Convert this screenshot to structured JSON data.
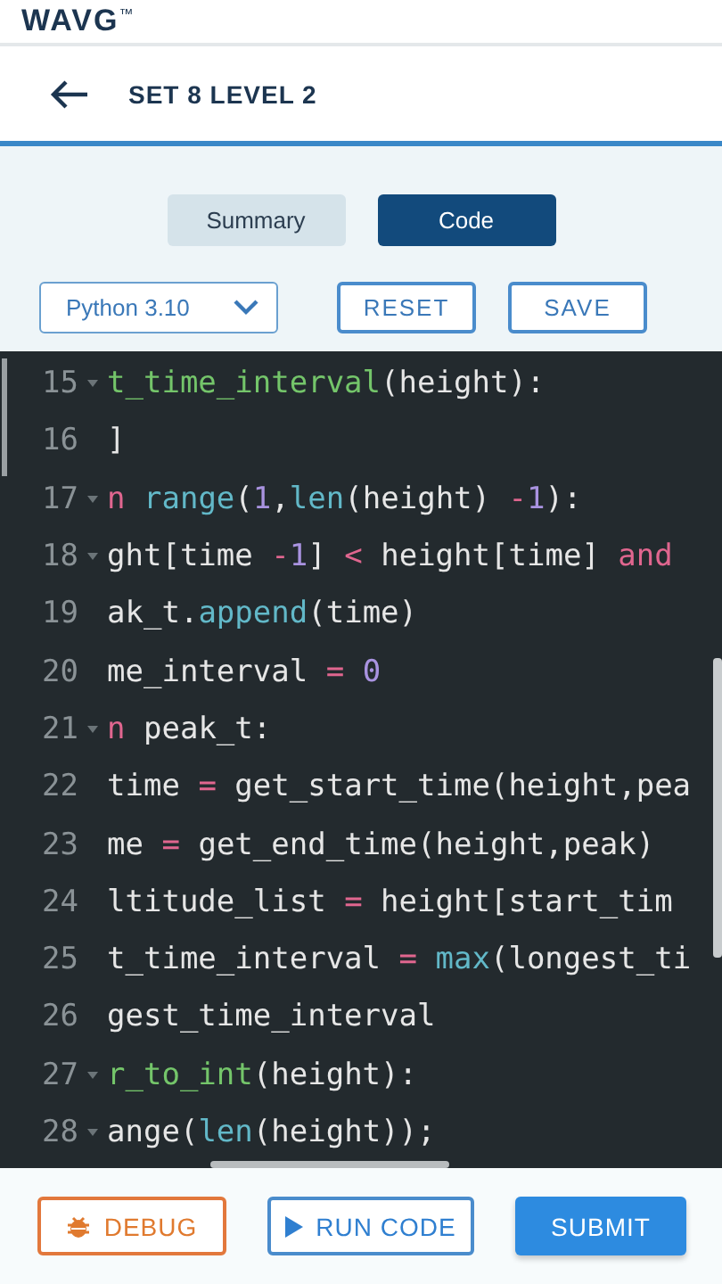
{
  "brand": {
    "logo": "WAVG",
    "mark": "™"
  },
  "header": {
    "title": "SET 8 LEVEL 2"
  },
  "tabs": [
    {
      "label": "Summary",
      "selected": false
    },
    {
      "label": "Code",
      "selected": true
    }
  ],
  "language_select": {
    "value": "Python 3.10"
  },
  "toolbar_buttons": [
    "RESET",
    "SAVE"
  ],
  "code_lines": [
    {
      "number": "15",
      "foldable": true,
      "tokens": [
        {
          "kind": "fn",
          "text": "t_time_interval"
        },
        {
          "kind": "plain",
          "text": "(height):"
        }
      ]
    },
    {
      "number": "16",
      "foldable": false,
      "tokens": [
        {
          "kind": "plain",
          "text": "]"
        }
      ]
    },
    {
      "number": "17",
      "foldable": true,
      "tokens": [
        {
          "kind": "kw",
          "text": "n"
        },
        {
          "kind": "builtin",
          "text": " range"
        },
        {
          "kind": "plain",
          "text": "("
        },
        {
          "kind": "num",
          "text": "1"
        },
        {
          "kind": "plain",
          "text": ","
        },
        {
          "kind": "builtin",
          "text": "len"
        },
        {
          "kind": "plain",
          "text": "(height) "
        },
        {
          "kind": "kw",
          "text": "-"
        },
        {
          "kind": "num",
          "text": "1"
        },
        {
          "kind": "plain",
          "text": "):"
        }
      ]
    },
    {
      "number": "18",
      "foldable": true,
      "tokens": [
        {
          "kind": "plain",
          "text": "ght[time "
        },
        {
          "kind": "kw",
          "text": "-"
        },
        {
          "kind": "num",
          "text": "1"
        },
        {
          "kind": "plain",
          "text": "] "
        },
        {
          "kind": "kw",
          "text": "<"
        },
        {
          "kind": "plain",
          "text": " height[time] "
        },
        {
          "kind": "kw",
          "text": "and"
        }
      ]
    },
    {
      "number": "19",
      "foldable": false,
      "tokens": [
        {
          "kind": "plain",
          "text": "ak_t."
        },
        {
          "kind": "builtin",
          "text": "append"
        },
        {
          "kind": "plain",
          "text": "(time)"
        }
      ]
    },
    {
      "number": "20",
      "foldable": false,
      "tokens": [
        {
          "kind": "plain",
          "text": "me_interval "
        },
        {
          "kind": "kw",
          "text": "="
        },
        {
          "kind": "num",
          "text": " 0"
        }
      ]
    },
    {
      "number": "21",
      "foldable": true,
      "tokens": [
        {
          "kind": "kw",
          "text": "n"
        },
        {
          "kind": "plain",
          "text": " peak_t:"
        }
      ]
    },
    {
      "number": "22",
      "foldable": false,
      "tokens": [
        {
          "kind": "plain",
          "text": "time "
        },
        {
          "kind": "kw",
          "text": "="
        },
        {
          "kind": "plain",
          "text": " get_start_time(height,pea"
        }
      ]
    },
    {
      "number": "23",
      "foldable": false,
      "tokens": [
        {
          "kind": "plain",
          "text": "me "
        },
        {
          "kind": "kw",
          "text": "="
        },
        {
          "kind": "plain",
          "text": " get_end_time(height,peak)"
        }
      ]
    },
    {
      "number": "24",
      "foldable": false,
      "tokens": [
        {
          "kind": "plain",
          "text": "ltitude_list "
        },
        {
          "kind": "kw",
          "text": "="
        },
        {
          "kind": "plain",
          "text": " height[start_tim"
        }
      ]
    },
    {
      "number": "25",
      "foldable": false,
      "tokens": [
        {
          "kind": "plain",
          "text": "t_time_interval "
        },
        {
          "kind": "kw",
          "text": "="
        },
        {
          "kind": "builtin",
          "text": " max"
        },
        {
          "kind": "plain",
          "text": "(longest_ti"
        }
      ]
    },
    {
      "number": "26",
      "foldable": false,
      "tokens": [
        {
          "kind": "plain",
          "text": "gest_time_interval"
        }
      ]
    },
    {
      "number": "27",
      "foldable": true,
      "tokens": [
        {
          "kind": "fn",
          "text": "r_to_int"
        },
        {
          "kind": "plain",
          "text": "(height):"
        }
      ]
    },
    {
      "number": "28",
      "foldable": true,
      "tokens": [
        {
          "kind": "plain",
          "text": "ange("
        },
        {
          "kind": "builtin",
          "text": "len"
        },
        {
          "kind": "plain",
          "text": "(height));"
        }
      ]
    }
  ],
  "footer_buttons": [
    {
      "kind": "debug",
      "label": "DEBUG"
    },
    {
      "kind": "run",
      "label": "RUN CODE"
    },
    {
      "kind": "submit",
      "label": "SUBMIT"
    }
  ]
}
